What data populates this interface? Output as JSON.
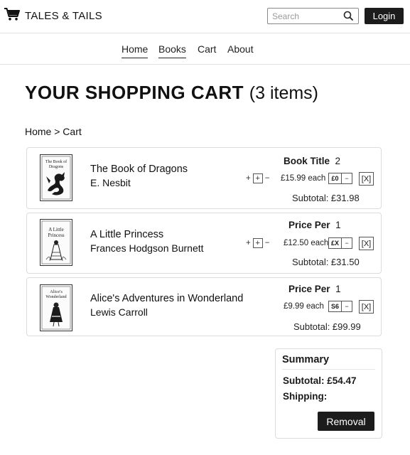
{
  "header": {
    "brand": "TALES & TAILS",
    "search_placeholder": "Search",
    "login_label": "Login"
  },
  "nav": {
    "items": [
      "Home",
      "Books",
      "Cart",
      "About"
    ]
  },
  "page": {
    "title": "YOUR SHOPPING CART",
    "item_count": "(3 items)",
    "breadcrumb": "Home > Cart"
  },
  "cart": [
    {
      "title": "The Book of Dragons",
      "author": "E. Nesbit",
      "header_label": "Book Title",
      "header_value": "2",
      "plus_label": "+",
      "minus_label": "−",
      "price": "£15.99 each",
      "qty_value": "£0",
      "qty_minus": "−",
      "remove_label": "[X]",
      "subtotal": "Subtotal: £31.98",
      "cover_text": "The Book of Dragons",
      "cover_icon": "dragon-icon"
    },
    {
      "title": "A Little Princess",
      "author": "Frances Hodgson Burnett",
      "header_label": "Price Per",
      "header_value": "1",
      "plus_label": "+",
      "minus_label": "−",
      "price": "£12.50 each",
      "qty_value": "£X",
      "qty_minus": "−",
      "remove_label": "[X]",
      "subtotal": "Subtotal: £31.50",
      "cover_text": "A Little Princess",
      "cover_icon": "princess-icon"
    },
    {
      "title": "Alice's Adventures in Wonderland",
      "author": "Lewis Carroll",
      "header_label": "Price Per",
      "header_value": "1",
      "price": "£9.99 each",
      "qty_value": "S6",
      "qty_minus": "−",
      "remove_label": "[X]",
      "subtotal": "Subtotal: £99.99",
      "cover_text": "Alice's Wonderland",
      "cover_icon": "alice-icon"
    }
  ],
  "summary": {
    "title": "Summary",
    "subtotal": "Subtotal: £54.47",
    "shipping": "Shipping:",
    "button_label": "Removal"
  },
  "colors": {
    "primary_button": "#1c1c1c",
    "border": "#dcdcdc"
  }
}
